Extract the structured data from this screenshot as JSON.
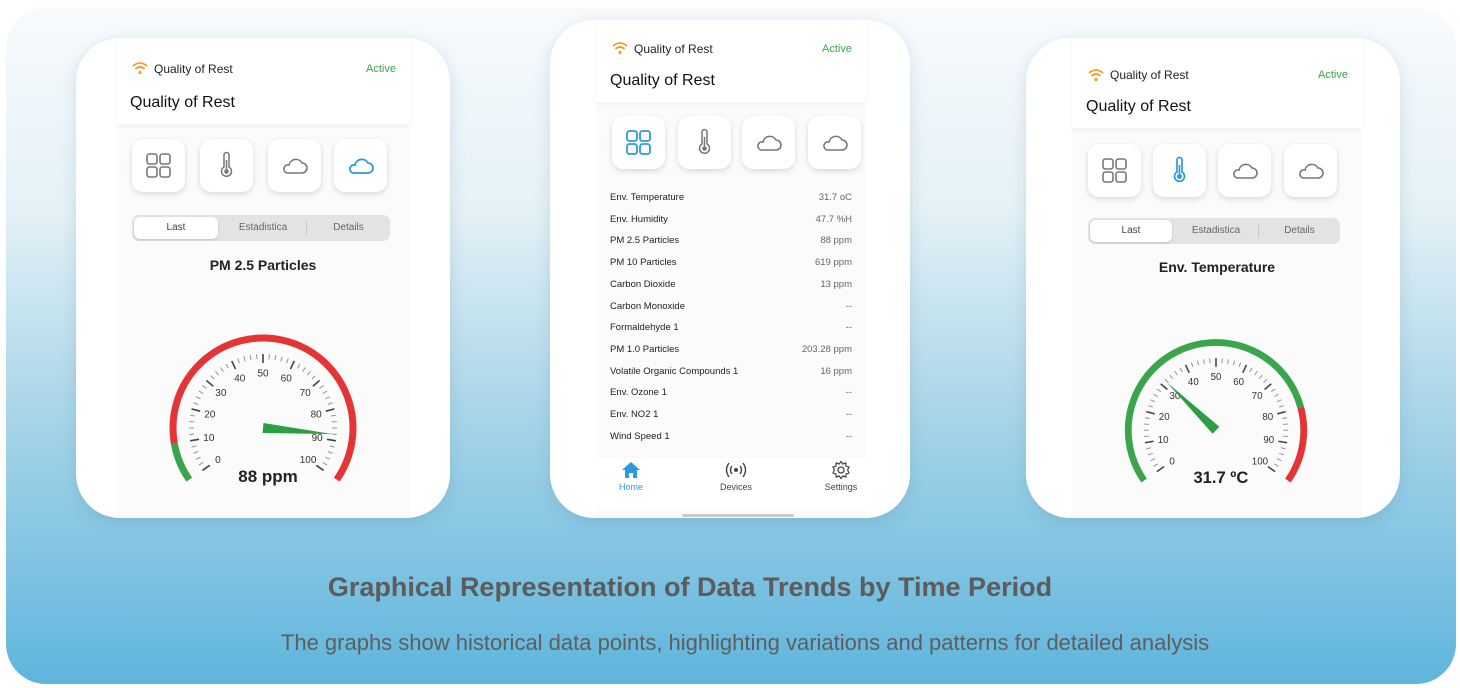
{
  "header": {
    "brand": "Quality of Rest",
    "status": "Active",
    "title": "Quality of Rest"
  },
  "phone1": {
    "tabs": [
      "Last",
      "Estadistica",
      "Details"
    ],
    "selected_tab": "Last",
    "active_icon": "cloud-icon",
    "gauge": {
      "title": "PM 2.5 Particles",
      "value": 88,
      "readout": "88 ppm",
      "min": 0,
      "max": 100,
      "ticks": [
        "0",
        "10",
        "20",
        "30",
        "40",
        "50",
        "60",
        "70",
        "80",
        "90",
        "100"
      ],
      "zones": [
        {
          "from": 0,
          "to": 10,
          "color": "#3aa64c"
        },
        {
          "from": 10,
          "to": 100,
          "color": "#e53434"
        }
      ]
    }
  },
  "phone2": {
    "active_icon": "grid-icon",
    "readings": [
      {
        "label": "Env. Temperature",
        "value": "31.7 oC"
      },
      {
        "label": "Env. Humidity",
        "value": "47.7 %H"
      },
      {
        "label": "PM 2.5 Particles",
        "value": "88 ppm"
      },
      {
        "label": "PM 10 Particles",
        "value": "619 ppm"
      },
      {
        "label": "Carbon Dioxide",
        "value": "13 ppm"
      },
      {
        "label": "Carbon Monoxide",
        "value": "--"
      },
      {
        "label": "Formaldehyde 1",
        "value": "--"
      },
      {
        "label": "PM 1.0 Particles",
        "value": "203.28 ppm"
      },
      {
        "label": "Volatile Organic Compounds 1",
        "value": "16 ppm"
      },
      {
        "label": "Env. Ozone 1",
        "value": "--"
      },
      {
        "label": "Env. NO2 1",
        "value": "--"
      },
      {
        "label": "Wind Speed 1",
        "value": "--"
      }
    ],
    "nav": [
      {
        "label": "Home",
        "icon": "home-icon",
        "active": true
      },
      {
        "label": "Devices",
        "icon": "signal-icon",
        "active": false
      },
      {
        "label": "Settings",
        "icon": "gear-icon",
        "active": false
      }
    ]
  },
  "phone3": {
    "tabs": [
      "Last",
      "Estadistica",
      "Details"
    ],
    "selected_tab": "Last",
    "active_icon": "thermometer-icon",
    "gauge": {
      "title": "Env. Temperature",
      "value": 31.7,
      "readout": "31.7 ºC",
      "min": 0,
      "max": 100,
      "ticks": [
        "0",
        "10",
        "20",
        "30",
        "40",
        "50",
        "60",
        "70",
        "80",
        "90",
        "100"
      ],
      "zones": [
        {
          "from": 0,
          "to": 80,
          "color": "#3aa64c"
        },
        {
          "from": 80,
          "to": 100,
          "color": "#e53434"
        }
      ]
    }
  },
  "caption": {
    "title": "Graphical Representation of Data Trends by Time Period",
    "subtitle": "The graphs show historical data points, highlighting variations and patterns for detailed analysis"
  },
  "colors": {
    "accent_blue": "#2d9ad9",
    "active_green": "#3aa64c",
    "zone_red": "#e53434",
    "zone_green": "#3aa64c",
    "needle_green": "#2e9e44"
  }
}
